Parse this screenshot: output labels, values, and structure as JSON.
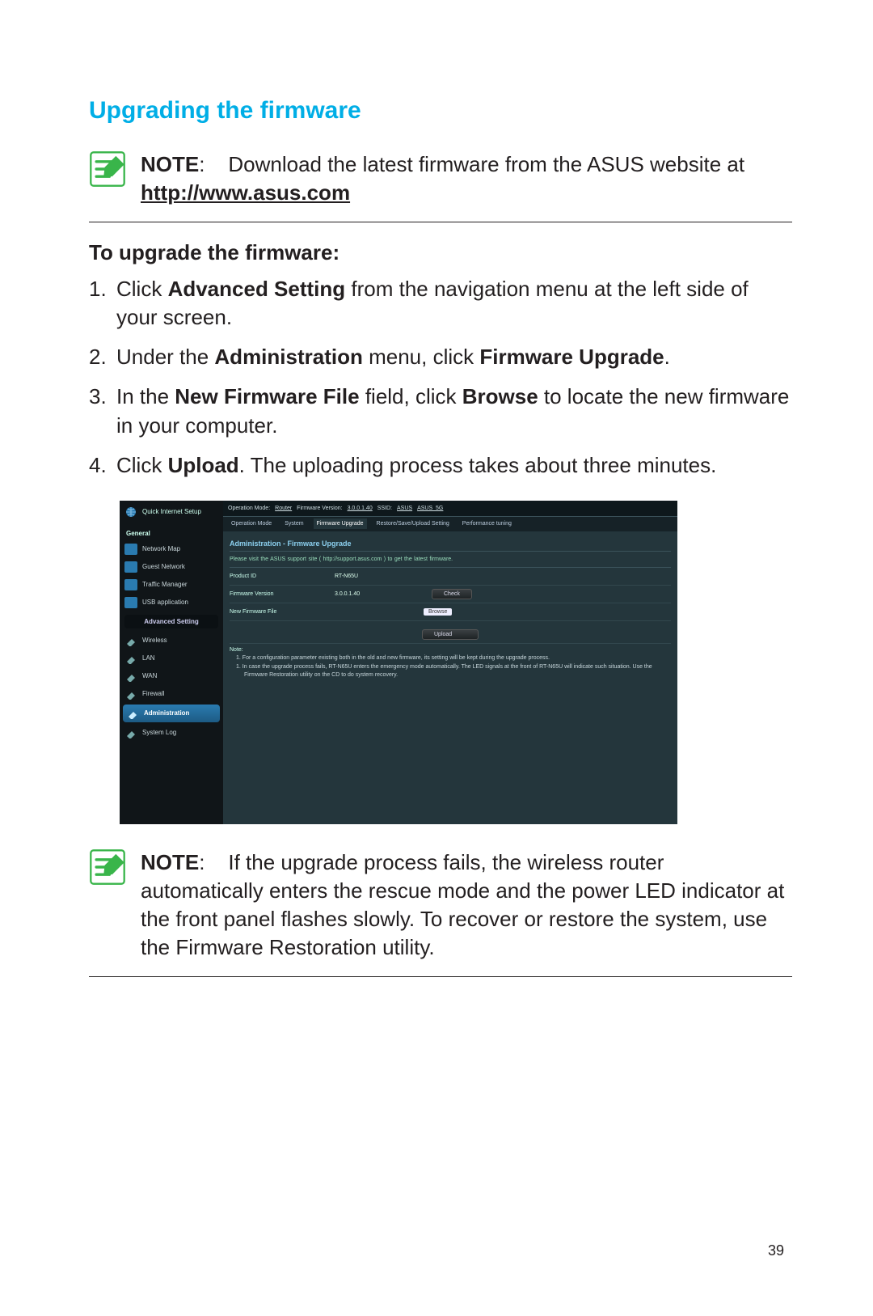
{
  "page": {
    "title": "Upgrading the firmware",
    "pageNumber": "39"
  },
  "note1": {
    "label": "NOTE",
    "text_before": "Download the latest firmware from the ASUS website at ",
    "url": "http://www.asus.com"
  },
  "subHeading": "To upgrade the firmware:",
  "steps": [
    {
      "num": "1.",
      "before": "Click ",
      "bold1": "Advanced Setting",
      "after1": " from the navigation menu at the left side of your screen."
    },
    {
      "num": "2.",
      "before": "Under the ",
      "bold1": "Administration",
      "after1": " menu, click ",
      "bold2": "Firmware Upgrade",
      "after2": "."
    },
    {
      "num": "3.",
      "before": "In the ",
      "bold1": "New Firmware File",
      "after1": " field, click ",
      "bold2": "Browse",
      "after2": " to locate the new firmware in your computer."
    },
    {
      "num": "4.",
      "before": "Click ",
      "bold1": "Upload",
      "after1": ". The uploading process takes about three minutes."
    }
  ],
  "screenshot": {
    "sidebar": {
      "quickSetup": "Quick Internet Setup",
      "sectionGeneral": "General",
      "items": [
        "Network Map",
        "Guest Network",
        "Traffic Manager",
        "USB application"
      ],
      "advLabel": "Advanced Setting",
      "advItems": [
        "Wireless",
        "LAN",
        "WAN",
        "Firewall",
        "Administration",
        "System Log"
      ]
    },
    "topbar": {
      "opModeLabel": "Operation Mode:",
      "opMode": "Router",
      "fwLabel": "Firmware Version:",
      "fw": "3.0.0.1.40",
      "ssidLabel": "SSID:",
      "ssid1": "ASUS",
      "ssid2": "ASUS_5G"
    },
    "tabs": [
      "Operation Mode",
      "System",
      "Firmware Upgrade",
      "Restore/Save/Upload Setting",
      "Performance tuning"
    ],
    "panel": {
      "title": "Administration - Firmware Upgrade",
      "hint": "Please visit the ASUS support site ( http://support.asus.com ) to get the latest firmware.",
      "productIdLabel": "Product ID",
      "productId": "RT-N65U",
      "fwVersionLabel": "Firmware Version",
      "fwVersion": "3.0.0.1.40",
      "checkBtn": "Check",
      "newFileLabel": "New Firmware File",
      "browseBtn": "Browse",
      "uploadBtn": "Upload",
      "noteLabel": "Note:",
      "noteItems": [
        "For a configuration parameter existing both in the old and new firmware, its setting will be kept during the upgrade process.",
        "In case the upgrade process fails, RT-N65U enters the emergency mode automatically. The LED signals at the front of RT-N65U will indicate such situation. Use the Firmware Restoration utility on the CD to do system recovery."
      ]
    }
  },
  "note2": {
    "label": "NOTE",
    "text": "If the upgrade process fails, the wireless router automatically enters the rescue mode and the power LED indicator at the front panel flashes slowly. To recover or restore the system, use the Firmware Restoration utility."
  }
}
